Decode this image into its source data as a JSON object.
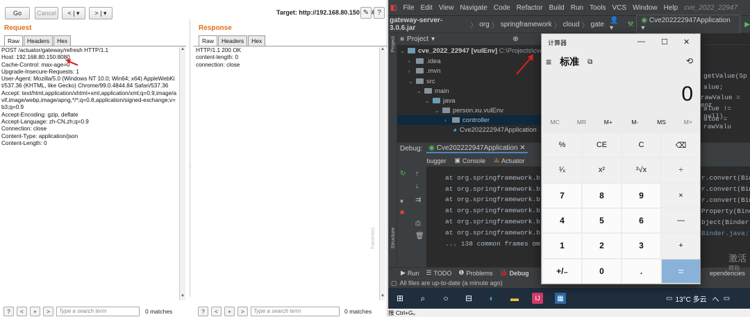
{
  "burp": {
    "go": "Go",
    "cancel": "Cancel",
    "back": "<",
    "back_menu": "▾",
    "fwd": ">",
    "fwd_menu": "▾",
    "target": "Target: http://192.168.80.150:8080",
    "edit_icon": "✎",
    "help_icon": "?",
    "request": {
      "title": "Request",
      "tabs": [
        "Raw",
        "Headers",
        "Hex"
      ],
      "text": "POST /actuator/gateway/refresh HTTP/1.1\nHost: 192.168.80.150:8080\nCache-Control: max-age=0\nUpgrade-Insecure-Requests: 1\nUser-Agent: Mozilla/5.0 (Windows NT 10.0; Win64; x64) AppleWebKit/537.36 (KHTML, like Gecko) Chrome/99.0.4844.84 Safari/537.36\nAccept: text/html,application/xhtml+xml,application/xml;q=0.9,image/avif,image/webp,image/apng,*/*;q=0.8,application/signed-exchange;v=b3;q=0.9\nAccept-Encoding: gzip, deflate\nAccept-Language: zh-CN,zh;q=0.9\nConnection: close\nContent-Type: application/json\nContent-Length: 0"
    },
    "response": {
      "title": "Response",
      "tabs": [
        "Raw",
        "Headers",
        "Hex"
      ],
      "text": "HTTP/1.1 200 OK\ncontent-length: 0\nconnection: close"
    },
    "search_placeholder": "Type a search term",
    "matches": "0 matches",
    "search_buttons": [
      "?",
      "<",
      "+",
      ">"
    ]
  },
  "ide": {
    "menu": [
      "File",
      "Edit",
      "View",
      "Navigate",
      "Code",
      "Refactor",
      "Build",
      "Run",
      "Tools",
      "VCS",
      "Window",
      "Help",
      "cve_2022_22947"
    ],
    "breadcrumb": [
      "gateway-server-3.0.6.jar",
      "org",
      "springframework",
      "cloud",
      "gate"
    ],
    "run_config": "Cve202222947Application",
    "project_label": "Project",
    "side_labels": {
      "project": "Project",
      "structure": "Structure",
      "favorites": "Favorites"
    },
    "tree": [
      {
        "label": "cve_2022_22947 [vulEnv]",
        "extra": "C:\\Projects\\cve_",
        "indent": 0
      },
      {
        "label": ".idea",
        "indent": 1
      },
      {
        "label": ".mvn",
        "indent": 1
      },
      {
        "label": "src",
        "indent": 1
      },
      {
        "label": "main",
        "indent": 2
      },
      {
        "label": "java",
        "indent": 3
      },
      {
        "label": "person.xu.vulEnv",
        "indent": 4
      },
      {
        "label": "controller",
        "indent": 5
      },
      {
        "label": "Cve202222947Application",
        "indent": 5
      }
    ],
    "code": [
      "  }",
      "",
      "  getValue(Sp",
      "alue;",
      " rawValue = ent",
      "alue != null)",
      "alue = rawValu"
    ],
    "debug": {
      "label": "Debug:",
      "config": "Cve202222947Application",
      "tabs": [
        "Debugger",
        "Console",
        "Actuator"
      ],
      "console": [
        "at org.springframework.b",
        "at org.springframework.b",
        "at org.springframework.b",
        "at org.springframework.b",
        "at org.springframework.b",
        "at org.springframework.b",
        "... 138 common frames om"
      ],
      "right_frag": [
        "r.convert(Bin",
        "r.convert(Bin",
        "r.convert(Bin",
        "Property(Binde",
        "bject(Binder.",
        "Binder.java:7"
      ]
    },
    "bottom_tabs": [
      "Run",
      "TODO",
      "Problems",
      "Debug",
      "ependencies"
    ],
    "status": "All files are up-to-date (a minute ago)",
    "tray": {
      "weather": "13°C 多云",
      "ime": "へ"
    },
    "hint": "按 Ctrl+G。"
  },
  "calc": {
    "title": "计算器",
    "mode": "标准",
    "display": "0",
    "memory": [
      "MC",
      "MR",
      "M+",
      "M-",
      "MS",
      "M˅"
    ],
    "keys": [
      "%",
      "CE",
      "C",
      "⌫",
      "¹⁄ₓ",
      "x²",
      "²√x",
      "÷",
      "7",
      "8",
      "9",
      "×",
      "4",
      "5",
      "6",
      "—",
      "1",
      "2",
      "3",
      "+",
      "+/₋",
      "0",
      ".",
      "="
    ]
  },
  "watermark": {
    "line1": "激活",
    "line2": "转到"
  },
  "colors": {
    "accent_orange": "#e26b1a",
    "ide_bg": "#2b2b2b",
    "calc_equals": "#8ab2d8"
  }
}
